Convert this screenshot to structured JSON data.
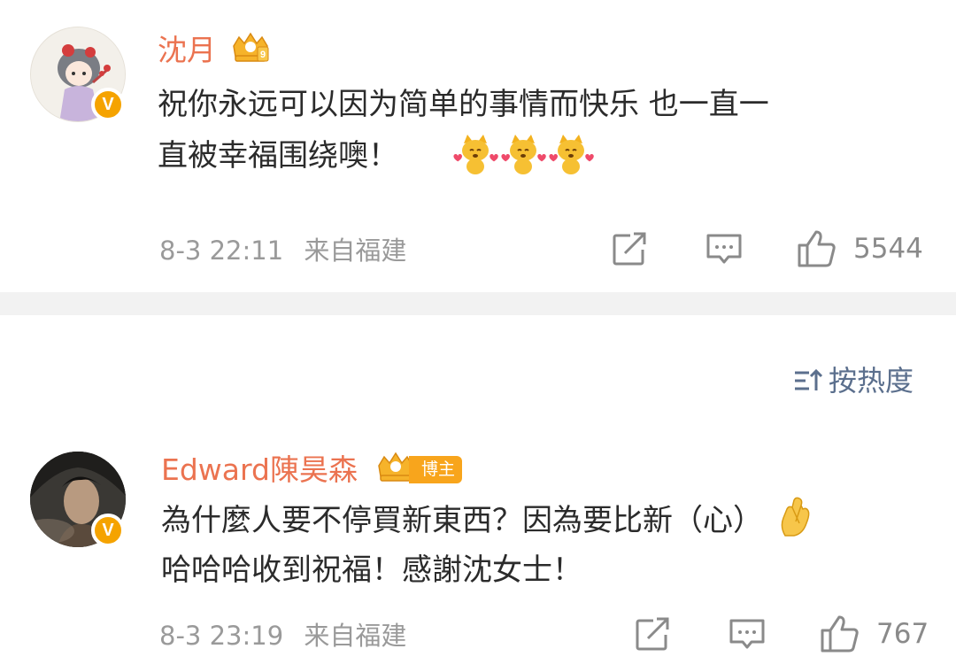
{
  "comments": [
    {
      "username": "沈月",
      "text_line1": "祝你永远可以因为简单的事情而快乐 也一直一",
      "text_line2": "直被幸福围绕噢！",
      "time": "8-3 22:11",
      "location": "来自福建",
      "likes": "5544",
      "verified_badge": "V",
      "avatar_icon": "cartoon-girl-avatar",
      "emojis": [
        "fox-hearts-emoji",
        "fox-hearts-emoji",
        "fox-hearts-emoji"
      ]
    },
    {
      "username": "Edward陳昊森",
      "text_line1": "為什麼人要不停買新東西？因為要比新（心）",
      "text_line2": "哈哈哈收到祝福！感謝沈女士！",
      "time": "8-3 23:19",
      "location": "来自福建",
      "likes": "767",
      "verified_badge": "V",
      "avatar_icon": "man-portrait-avatar",
      "tag": "博主",
      "emojis": [
        "crossed-fingers-heart-emoji"
      ]
    }
  ],
  "sort": {
    "label": "按热度"
  },
  "colors": {
    "username": "#eb7350",
    "text": "#2b2b2b",
    "meta": "#9a9a9a",
    "sort": "#5b6f8d",
    "verified": "#f5a300",
    "divider": "#f2f2f2"
  }
}
